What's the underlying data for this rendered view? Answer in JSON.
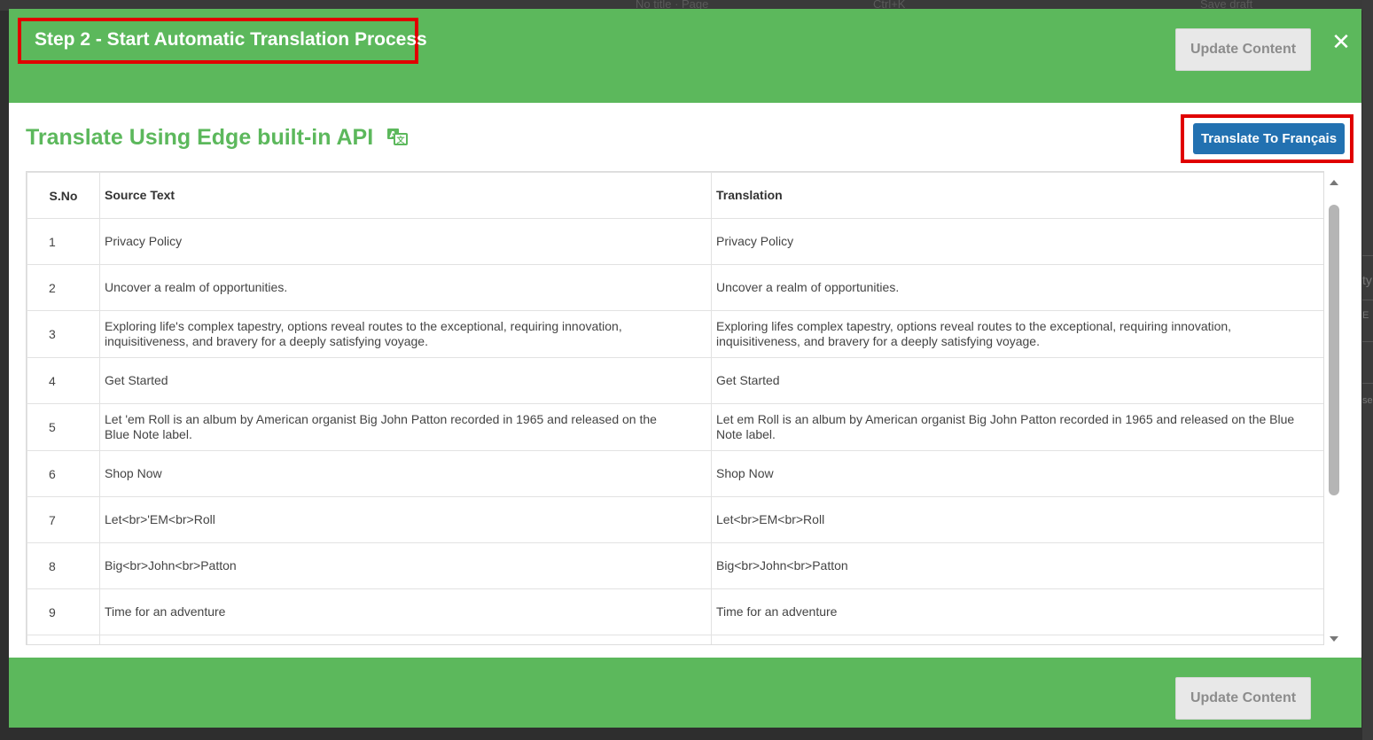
{
  "background": {
    "title_fragment": "No title · Page",
    "shortcut_fragment": "Ctrl+K",
    "save_fragment": "Save draft",
    "right_fragments": [
      "ty",
      "E",
      "se"
    ]
  },
  "modal": {
    "header": {
      "title": "Step 2 - Start Automatic Translation Process",
      "update_button": "Update Content",
      "close_icon": "close-icon"
    },
    "section_title": "Translate Using Edge built-in API",
    "translate_icon": "translate-icon",
    "translate_button": "Translate To Français",
    "table": {
      "columns": [
        "S.No",
        "Source Text",
        "Translation"
      ],
      "rows": [
        {
          "sno": "1",
          "source": "Privacy Policy",
          "translation": "Privacy Policy"
        },
        {
          "sno": "2",
          "source": "Uncover a realm of opportunities.",
          "translation": "Uncover a realm of opportunities."
        },
        {
          "sno": "3",
          "source": "Exploring life's complex tapestry, options reveal routes to the exceptional, requiring innovation, inquisitiveness, and bravery for a deeply satisfying voyage.",
          "translation": "Exploring lifes complex tapestry, options reveal routes to the exceptional, requiring innovation, inquisitiveness, and bravery for a deeply satisfying voyage."
        },
        {
          "sno": "4",
          "source": "Get Started",
          "translation": "Get Started"
        },
        {
          "sno": "5",
          "source": "Let 'em Roll is an album by American organist Big John Patton recorded in 1965 and released on the Blue Note label.",
          "translation": "Let em Roll is an album by American organist Big John Patton recorded in 1965 and released on the Blue Note label."
        },
        {
          "sno": "6",
          "source": "Shop Now",
          "translation": "Shop Now"
        },
        {
          "sno": "7",
          "source": "Let<br>'EM<br>Roll",
          "translation": "Let<br>EM<br>Roll"
        },
        {
          "sno": "8",
          "source": "Big<br>John<br>Patton",
          "translation": "Big<br>John<br>Patton"
        },
        {
          "sno": "9",
          "source": "Time for an adventure",
          "translation": "Time for an adventure"
        },
        {
          "sno": "",
          "source": "",
          "translation": ""
        }
      ]
    },
    "footer": {
      "update_button": "Update Content"
    },
    "colors": {
      "header_green": "#5cb85c",
      "button_blue": "#2271b1",
      "highlight_red": "#e00000"
    }
  }
}
